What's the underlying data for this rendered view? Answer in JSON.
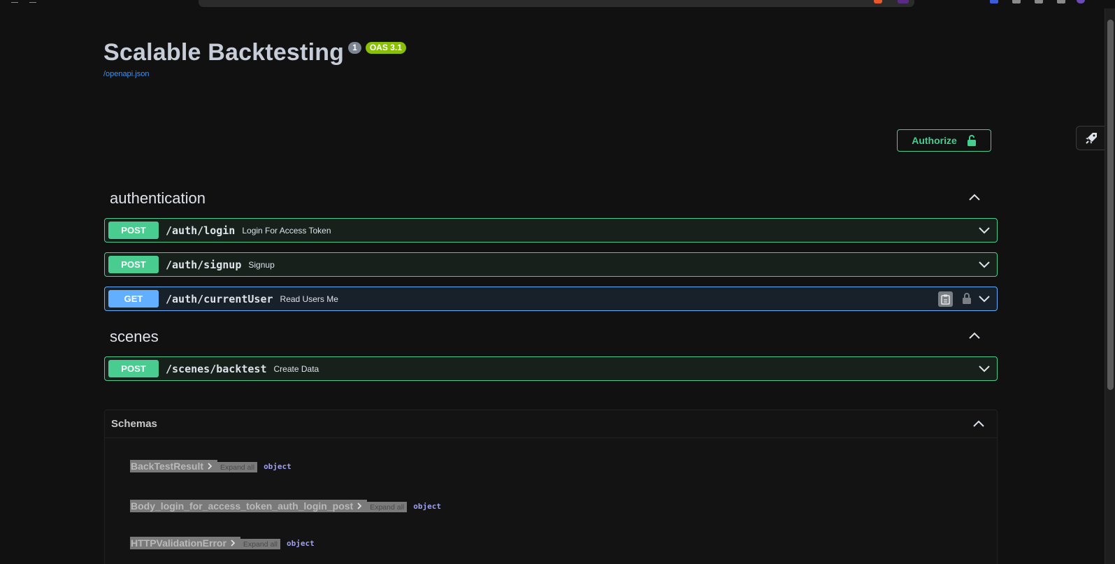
{
  "info": {
    "title": "Scalable Backtesting",
    "version_badge": "1",
    "oas_badge": "OAS 3.1",
    "spec_link": "/openapi.json"
  },
  "authorize": {
    "label": "Authorize"
  },
  "tags": [
    {
      "name": "authentication",
      "operations": [
        {
          "method": "POST",
          "path": "/auth/login",
          "summary": "Login For Access Token"
        },
        {
          "method": "POST",
          "path": "/auth/signup",
          "summary": "Signup"
        },
        {
          "method": "GET",
          "path": "/auth/currentUser",
          "summary": "Read Users Me"
        }
      ]
    },
    {
      "name": "scenes",
      "operations": [
        {
          "method": "POST",
          "path": "/scenes/backtest",
          "summary": "Create Data"
        }
      ]
    }
  ],
  "schemas": {
    "title": "Schemas",
    "models": [
      {
        "name": "BackTestResult",
        "expand": "Expand all",
        "type": "object"
      },
      {
        "name": "Body_login_for_access_token_auth_login_post",
        "expand": "Expand all",
        "type": "object"
      },
      {
        "name": "HTTPValidationError",
        "expand": "Expand all",
        "type": "object"
      }
    ]
  },
  "colors": {
    "post": "#49cc90",
    "get": "#61affe",
    "oas_badge": "#89bf04",
    "link": "#4990e2",
    "background": "#111111"
  },
  "icons": [
    "lock-open-icon",
    "chevron-up-icon",
    "chevron-down-icon",
    "copy-icon",
    "lock-icon",
    "chevron-right-icon",
    "rocket-icon"
  ]
}
